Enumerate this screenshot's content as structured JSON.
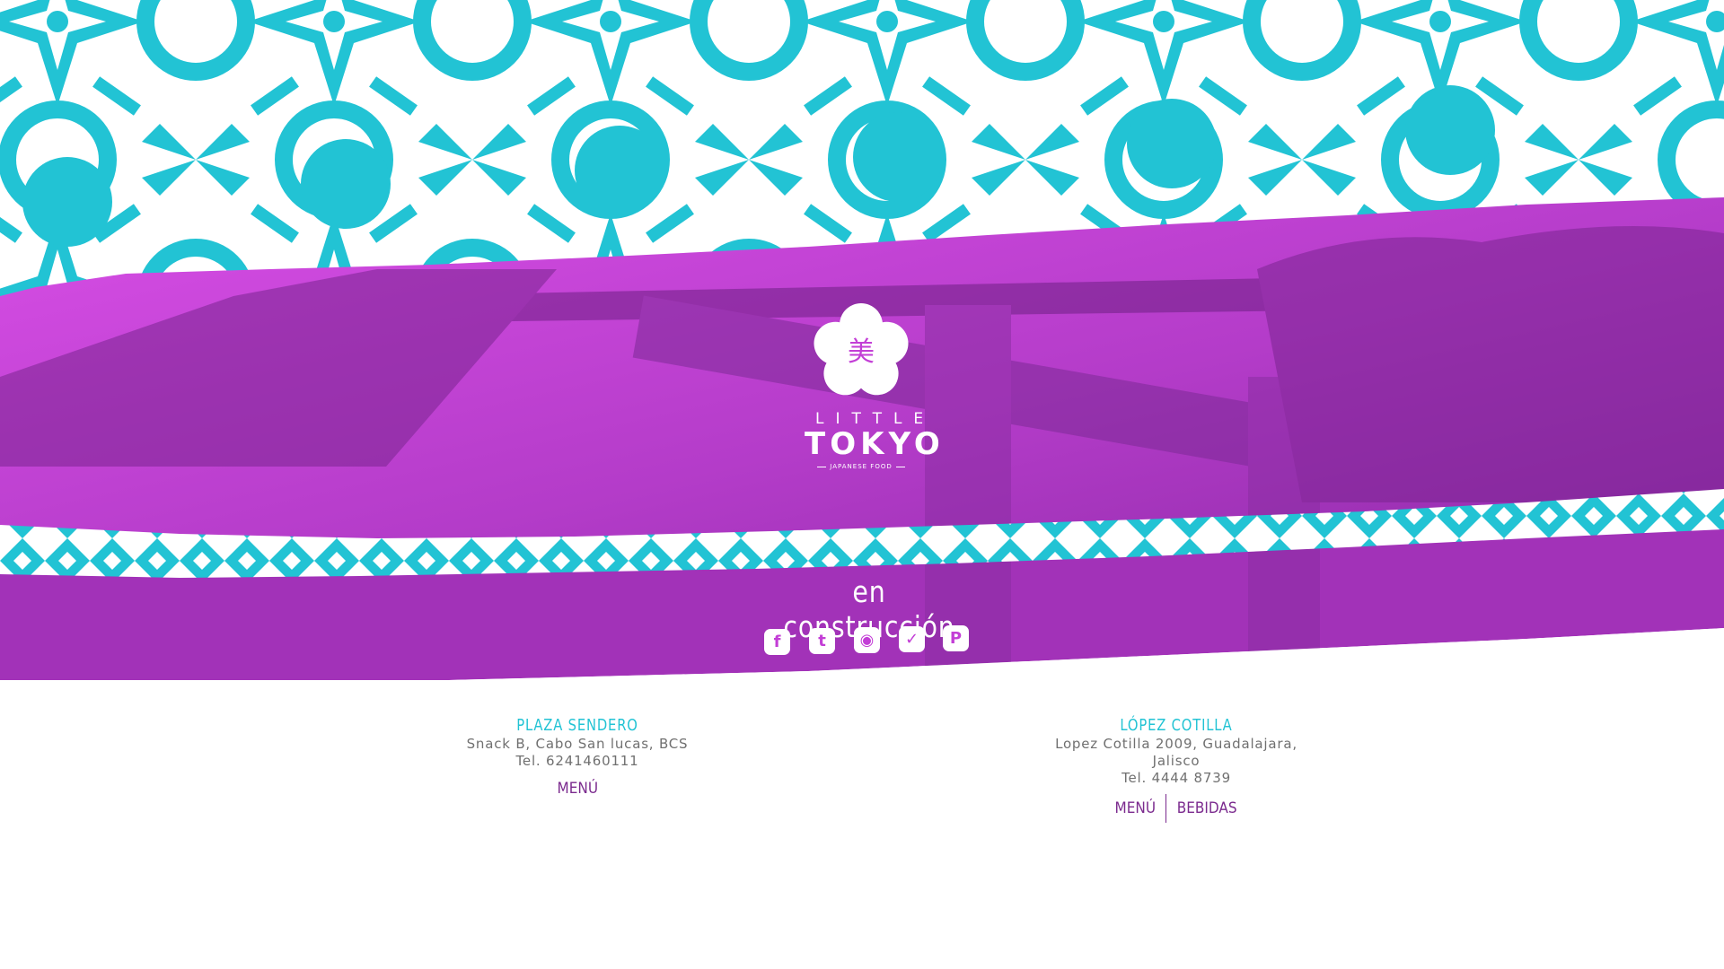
{
  "colors": {
    "teal": "#22c3d4",
    "magenta": "#c33ed6",
    "purple": "#7b2a8e",
    "gray": "#707070"
  },
  "logo": {
    "glyph": "美",
    "line1": "LITTLE",
    "line2": "TOKYO",
    "tagline": "JAPANESE FOOD"
  },
  "status_text": "en construcción",
  "social": [
    {
      "name": "facebook-icon",
      "glyph": "f"
    },
    {
      "name": "twitter-icon",
      "glyph": "t"
    },
    {
      "name": "instagram-icon",
      "glyph": "◉"
    },
    {
      "name": "foursquare-icon",
      "glyph": "✓"
    },
    {
      "name": "pinterest-icon",
      "glyph": "P"
    }
  ],
  "locations": [
    {
      "title": "PLAZA SENDERO",
      "address": "Snack B, Cabo San lucas, BCS",
      "phone": "Tel. 6241460111",
      "links": [
        "MENÚ"
      ]
    },
    {
      "title": "LÓPEZ COTILLA",
      "address": "Lopez Cotilla 2009, Guadalajara, Jalisco",
      "phone": "Tel. 4444 8739",
      "links": [
        "MENÚ",
        "BEBIDAS"
      ]
    }
  ]
}
